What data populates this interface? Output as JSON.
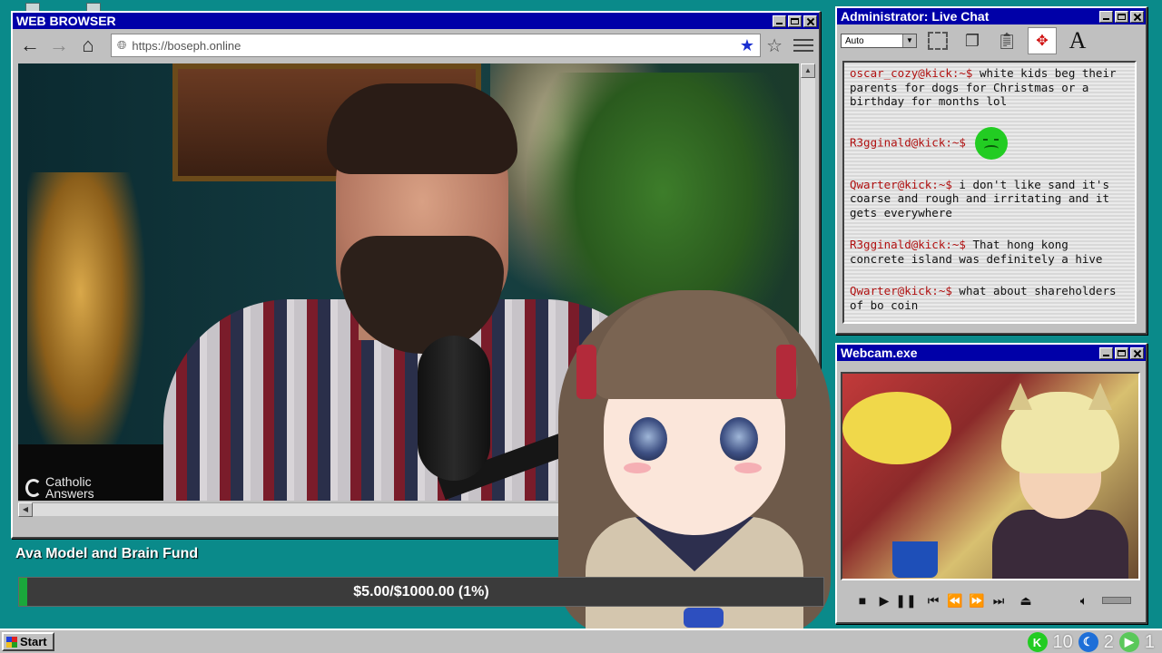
{
  "browser": {
    "title": "WEB BROWSER",
    "url": "https://boseph.online",
    "nav": {
      "back": "←",
      "forward": "→",
      "home": "⌂"
    },
    "video": {
      "overlay_logo": "Catholic Answers"
    }
  },
  "fund": {
    "title": "Ava Model and Brain Fund",
    "status": "$5.00/$1000.00 (1%)",
    "progress_fraction": 0.01,
    "fill_color": "#1aa83b"
  },
  "chat": {
    "title": "Administrator: Live Chat",
    "font_select": "Auto",
    "messages": [
      {
        "user": "oscar_cozy@kick:~$",
        "text": " white kids beg their parents for dogs for Christmas or a birthday for months lol"
      },
      {
        "user": "R3gginald@kick:~$",
        "text": "",
        "emote": "green-sad-face-emote"
      },
      {
        "user": "Qwarter@kick:~$",
        "text": " i don't like sand it's coarse and rough and irritating and it gets everywhere"
      },
      {
        "user": "R3gginald@kick:~$",
        "text": " That hong kong concrete island was definitely a hive"
      },
      {
        "user": "Qwarter@kick:~$",
        "text": " what about shareholders of bo coin"
      }
    ]
  },
  "webcam": {
    "title": "Webcam.exe"
  },
  "taskbar": {
    "start_label": "Start",
    "tray": [
      {
        "icon": "kick-icon",
        "glyph": "K",
        "color": "#22cc22",
        "value": "10"
      },
      {
        "icon": "moon-icon",
        "glyph": "☾",
        "color": "#1e6fd8",
        "value": "2"
      },
      {
        "icon": "play-circle-icon",
        "glyph": "▶",
        "color": "#5ac85a",
        "value": "1"
      }
    ]
  }
}
